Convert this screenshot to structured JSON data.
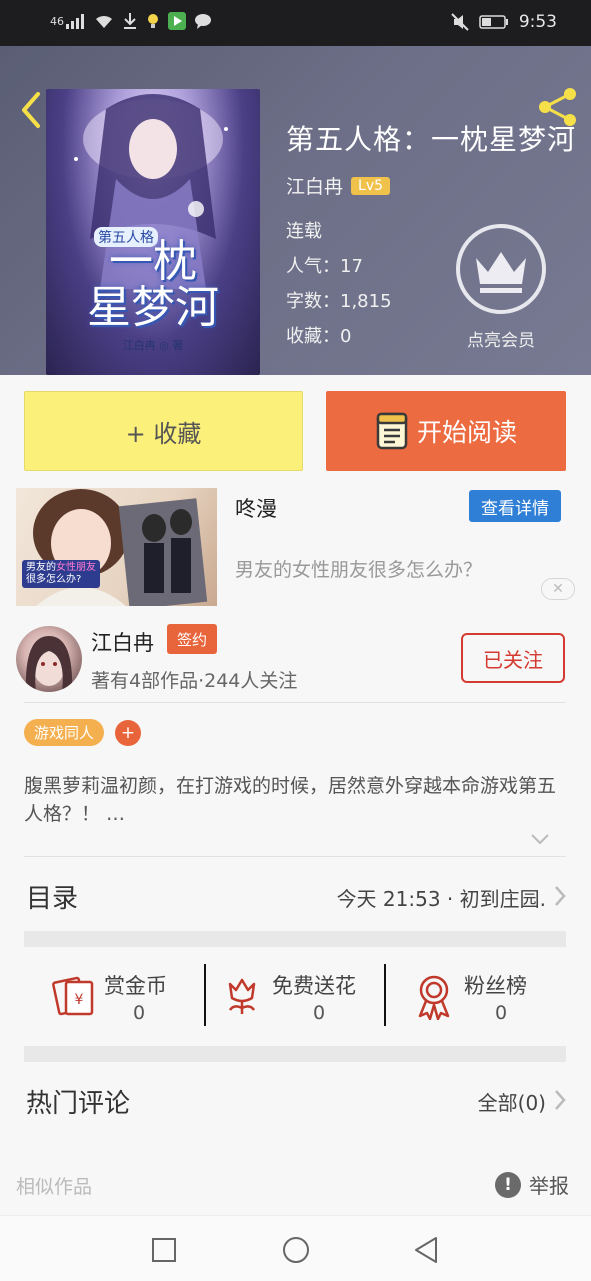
{
  "status_bar": {
    "network": "46",
    "time": "9:53",
    "icons": [
      "signal-icon",
      "wifi-icon",
      "download-icon",
      "bulb-icon",
      "play-store-icon",
      "chat-icon",
      "mute-icon",
      "battery-icon"
    ]
  },
  "book": {
    "title": "第五人格：一枕星梦河",
    "cover_title_line1": "一枕",
    "cover_title_line2": "星梦河",
    "cover_tag": "第五人格",
    "cover_author": "江白冉 ◎ 著",
    "author": "江白冉",
    "level": "Lv5",
    "status": "连载",
    "popularity": "人气：17",
    "word_count": "字数：1,815",
    "favorites": "收藏：0",
    "vip_label": "点亮会员"
  },
  "actions": {
    "collect": "+ 收藏",
    "read": "开始阅读"
  },
  "ad": {
    "title": "咚漫",
    "detail_button": "查看详情",
    "description": "男友的女性朋友很多怎么办？",
    "image_caption_1": "男友的",
    "image_caption_2": "女性朋友",
    "image_caption_3": "很多怎么办?"
  },
  "author_card": {
    "name": "江白冉",
    "badge": "签约",
    "subtitle": "著有4部作品·244人关注",
    "follow_button": "已关注"
  },
  "tags": {
    "genre": "游戏同人",
    "add": "+"
  },
  "description": "腹黑萝莉温初颜，在打游戏的时候，居然意外穿越本命游戏第五人格？！ …",
  "catalog": {
    "title": "目录",
    "latest": "今天 21:53 · 初到庄园."
  },
  "stats": [
    {
      "label": "赏金币",
      "value": "0"
    },
    {
      "label": "免费送花",
      "value": "0"
    },
    {
      "label": "粉丝榜",
      "value": "0"
    }
  ],
  "comments": {
    "title": "热门评论",
    "all": "全部(0)"
  },
  "footer": {
    "similar": "相似作品",
    "report": "举报",
    "report_icon": "!"
  },
  "colors": {
    "accent_orange": "#ed6b41",
    "collect_yellow": "#fbf07a",
    "follow_red": "#d43a30",
    "tag_orange": "#f4b04f",
    "link_blue": "#2f7fd6"
  }
}
